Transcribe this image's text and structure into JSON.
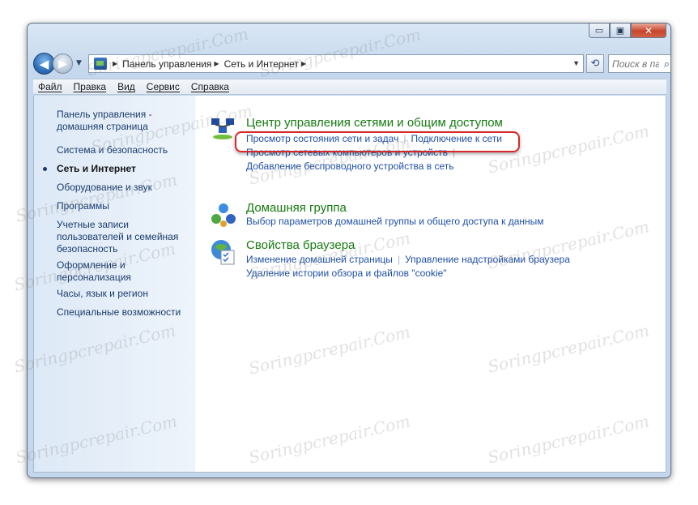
{
  "window": {
    "minimize_label": "▭",
    "maximize_label": "▣",
    "close_label": "✕"
  },
  "nav": {
    "back_label": "◀",
    "forward_label": "▶",
    "breadcrumb": [
      "Панель управления",
      "Сеть и Интернет"
    ],
    "search_placeholder": "Поиск в па..."
  },
  "menubar": {
    "items": [
      "Файл",
      "Правка",
      "Вид",
      "Сервис",
      "Справка"
    ]
  },
  "sidebar": {
    "items": [
      "Панель управления - домашняя страница",
      "Система и безопасность",
      "Сеть и Интернет",
      "Оборудование и звук",
      "Программы",
      "Учетные записи пользователей и семейная безопасность",
      "Оформление и персонализация",
      "Часы, язык и регион",
      "Специальные возможности"
    ],
    "active_index": 2
  },
  "categories": [
    {
      "title": "Центр управления сетями и общим доступом",
      "icon": "network-center-icon",
      "links": [
        [
          "Просмотр состояния сети и задач",
          "Подключение к сети"
        ],
        [
          "Просмотр сетевых компьютеров и устройств"
        ],
        [
          "Добавление беспроводного устройства в сеть"
        ]
      ]
    },
    {
      "title": "Домашняя группа",
      "icon": "homegroup-icon",
      "links": [
        [
          "Выбор параметров домашней группы и общего доступа к данным"
        ]
      ]
    },
    {
      "title": "Свойства браузера",
      "icon": "browser-properties-icon",
      "links": [
        [
          "Изменение домашней страницы",
          "Управление надстройками браузера"
        ],
        [
          "Удаление истории обзора и файлов \"cookie\""
        ]
      ]
    }
  ],
  "watermark_text": "Soringpcrepair.Com",
  "colors": {
    "category_title": "#157b10",
    "link": "#1e4fa6",
    "sidebar_link": "#1c3b6b",
    "highlight": "#d62a2a"
  }
}
